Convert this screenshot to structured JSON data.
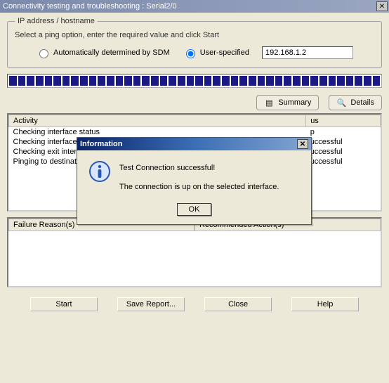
{
  "window": {
    "title": "Connectivity testing and troubleshooting : Serial2/0"
  },
  "groupbox": {
    "legend": "IP address / hostname",
    "instruction": "Select a ping option, enter the required value and click Start",
    "radio_auto": "Automatically determined by SDM",
    "radio_user": "User-specified",
    "ip_value": "192.168.1.2"
  },
  "toolbar": {
    "summary": "Summary",
    "details": "Details"
  },
  "table": {
    "col_activity": "Activity",
    "col_status": "us",
    "rows": [
      {
        "activity": "Checking interface status",
        "status": "p"
      },
      {
        "activity": "Checking interface",
        "status": "uccessful"
      },
      {
        "activity": "Checking exit interface",
        "status": "uccessful"
      },
      {
        "activity": "Pinging to destination",
        "status": "uccessful"
      }
    ]
  },
  "lower": {
    "failure": "Failure Reason(s)",
    "recommended": "Recommended Action(s)"
  },
  "buttons": {
    "start": "Start",
    "save": "Save Report...",
    "close": "Close",
    "help": "Help"
  },
  "dialog": {
    "title": "Information",
    "line1": "Test Connection successful!",
    "line2": "The connection is up on the selected interface.",
    "ok": "OK"
  }
}
